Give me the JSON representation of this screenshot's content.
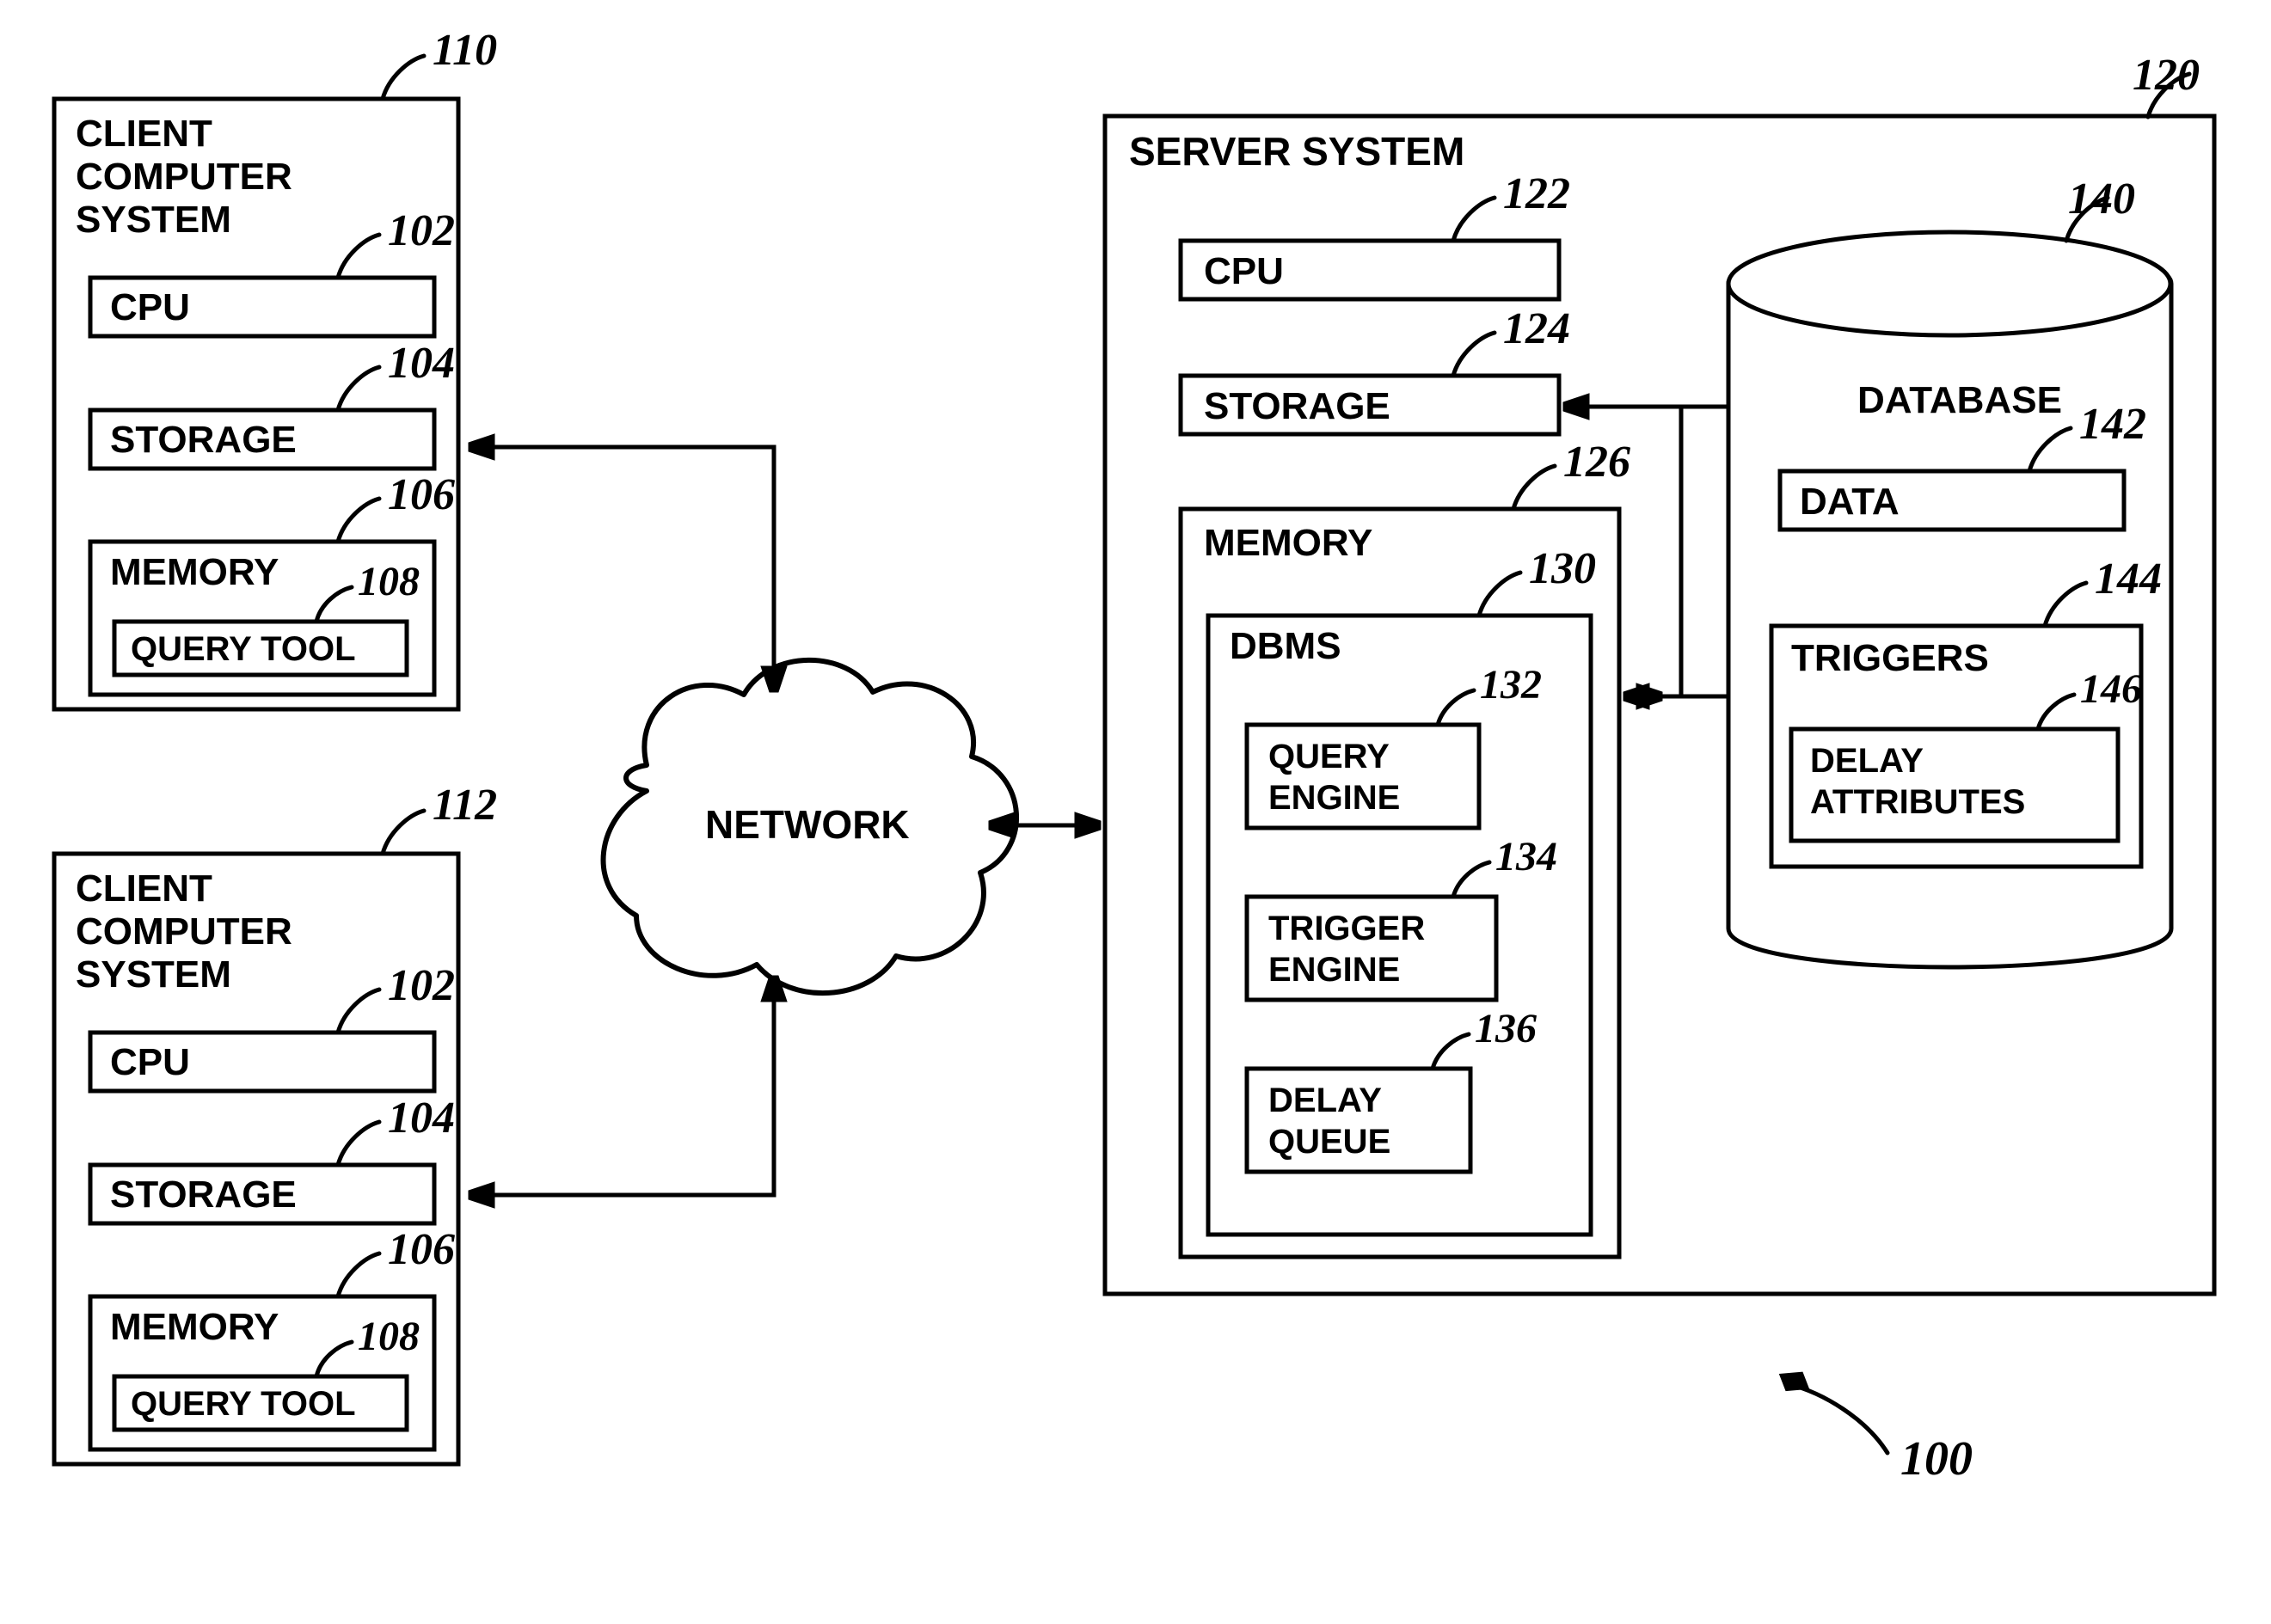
{
  "labels": {
    "client_title": "CLIENT\nCOMPUTER\nSYSTEM",
    "cpu": "CPU",
    "storage": "STORAGE",
    "memory": "MEMORY",
    "query_tool": "QUERY TOOL",
    "server_title": "SERVER SYSTEM",
    "dbms": "DBMS",
    "query_engine": "QUERY\nENGINE",
    "trigger_engine": "TRIGGER\nENGINE",
    "delay_queue": "DELAY\nQUEUE",
    "database": "DATABASE",
    "data": "DATA",
    "triggers": "TRIGGERS",
    "delay_attributes": "DELAY\nATTRIBUTES",
    "network": "NETWORK"
  },
  "refs": {
    "client1": "110",
    "client2": "112",
    "cpu_c": "102",
    "storage_c": "104",
    "memory_c": "106",
    "query_tool": "108",
    "server": "120",
    "cpu_s": "122",
    "storage_s": "124",
    "memory_s": "126",
    "dbms": "130",
    "query_engine": "132",
    "trigger_engine": "134",
    "delay_queue": "136",
    "database": "140",
    "data": "142",
    "triggers": "144",
    "delay_attributes": "146",
    "figure": "100"
  }
}
